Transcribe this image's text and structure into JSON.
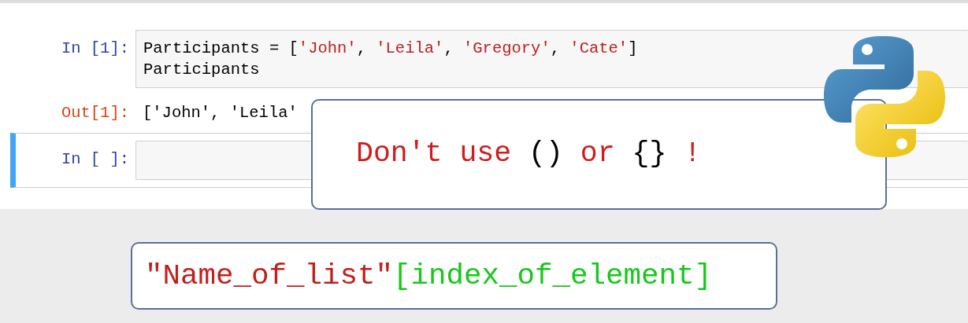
{
  "cells": [
    {
      "kind": "input",
      "prompt": "In [1]:",
      "selected": false,
      "lines": [
        [
          {
            "text": "Participants = [",
            "kind": "plain"
          },
          {
            "text": "'John'",
            "kind": "string"
          },
          {
            "text": ", ",
            "kind": "plain"
          },
          {
            "text": "'Leila'",
            "kind": "string"
          },
          {
            "text": ", ",
            "kind": "plain"
          },
          {
            "text": "'Gregory'",
            "kind": "string"
          },
          {
            "text": ", ",
            "kind": "plain"
          },
          {
            "text": "'Cate'",
            "kind": "string"
          },
          {
            "text": "]",
            "kind": "plain"
          }
        ],
        [
          {
            "text": "Participants",
            "kind": "plain"
          }
        ]
      ]
    },
    {
      "kind": "output",
      "prompt": "Out[1]:",
      "selected": false,
      "lines": [
        [
          {
            "text": "['John', 'Leila'",
            "kind": "plain"
          }
        ]
      ]
    },
    {
      "kind": "input",
      "prompt": "In [ ]:",
      "selected": true
    }
  ],
  "callout": [
    {
      "text": "Don't use ",
      "kind": "red"
    },
    {
      "text": "()",
      "kind": "black"
    },
    {
      "text": " or ",
      "kind": "red"
    },
    {
      "text": "{}",
      "kind": "black"
    },
    {
      "text": " !",
      "kind": "red"
    }
  ],
  "formula": [
    {
      "text": "\"Name_of_list\"",
      "kind": "red"
    },
    {
      "text": "[index_of_element]",
      "kind": "green"
    }
  ]
}
